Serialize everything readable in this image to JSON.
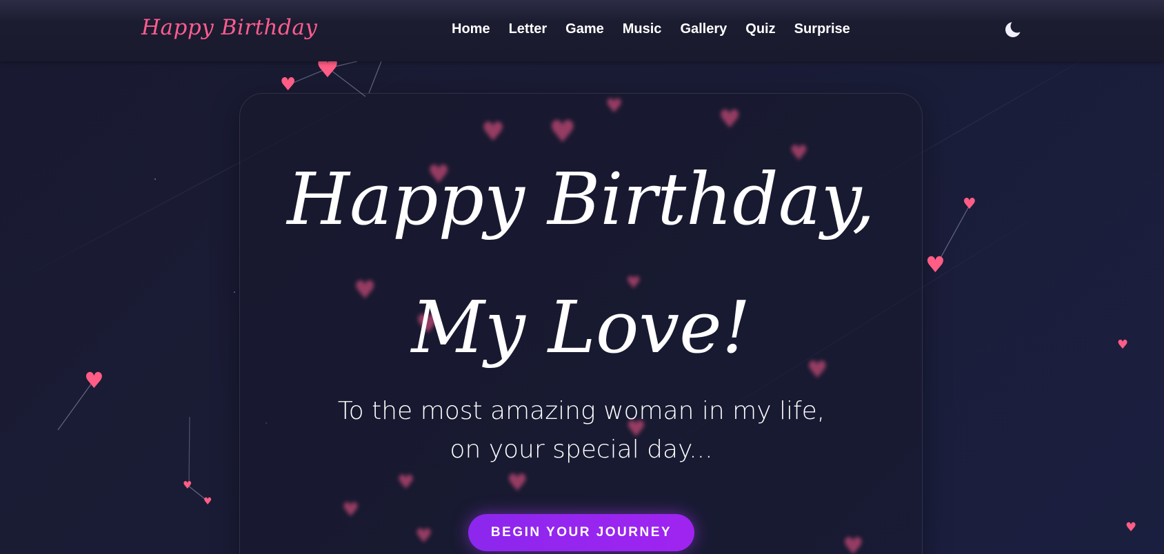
{
  "brand": {
    "title": "Happy Birthday",
    "color": "#ff5d8f"
  },
  "nav": {
    "items": [
      {
        "label": "Home"
      },
      {
        "label": "Letter"
      },
      {
        "label": "Game"
      },
      {
        "label": "Music"
      },
      {
        "label": "Gallery"
      },
      {
        "label": "Quiz"
      },
      {
        "label": "Surprise"
      }
    ],
    "theme_toggle_icon": "moon-icon"
  },
  "hero": {
    "title": "Happy Birthday, My Love!",
    "subtitle": "To the most amazing woman in my life, on your special day...",
    "cta_label": "BEGIN YOUR JOURNEY"
  },
  "colors": {
    "background": "#1a1c35",
    "accent_pink": "#ff5d85",
    "button_purple": "#9526ef"
  },
  "decorations": {
    "heart_icon": "heart-icon"
  }
}
